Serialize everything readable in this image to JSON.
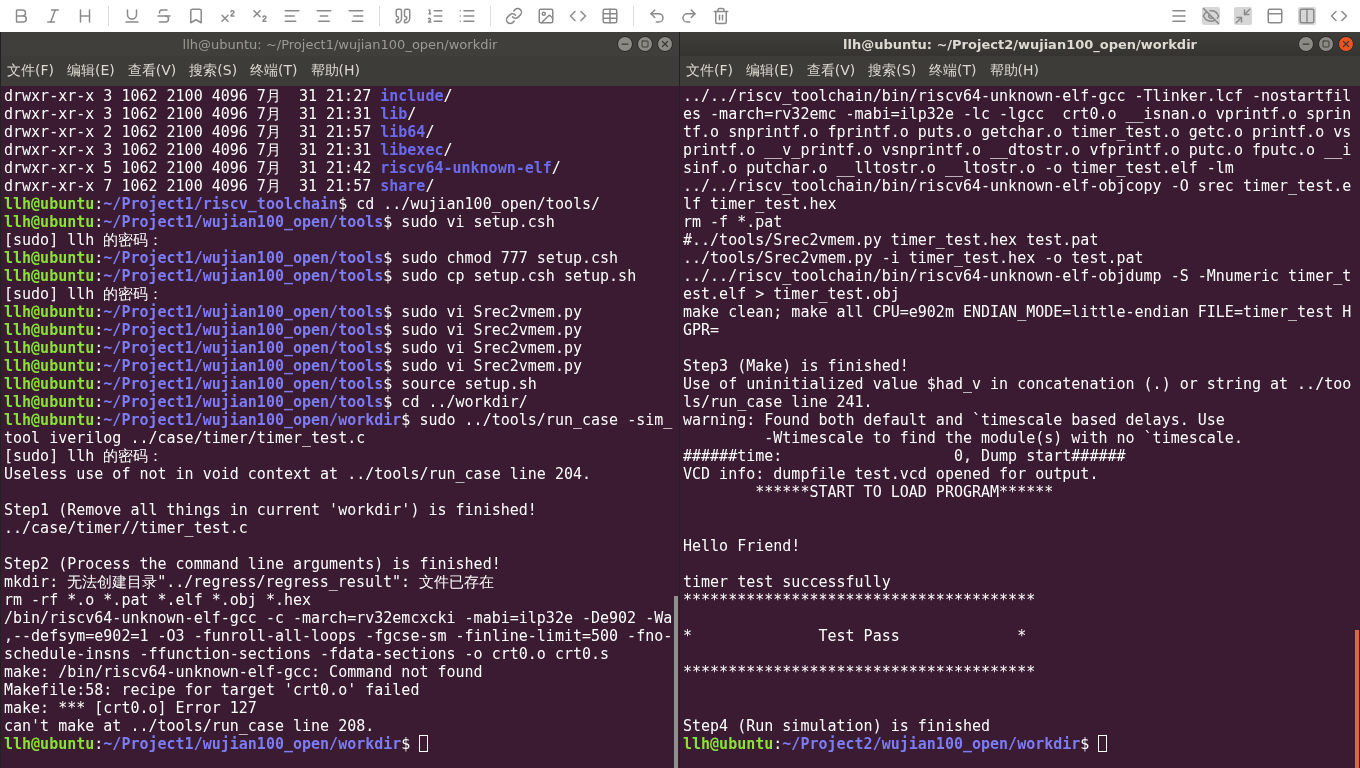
{
  "windows": [
    {
      "title": "llh@ubuntu: ~/Project1/wujian100_open/workdir",
      "active": false,
      "menu": [
        "文件(F)",
        "编辑(E)",
        "查看(V)",
        "搜索(S)",
        "终端(T)",
        "帮助(H)"
      ],
      "lines": [
        {
          "kind": "text",
          "segments": [
            {
              "kind": "plain",
              "text": "drwxr-xr-x 3 1062 2100 4096 7月  31 21:27 "
            },
            {
              "kind": "dir",
              "text": "include"
            },
            {
              "kind": "plain",
              "text": "/"
            }
          ]
        },
        {
          "kind": "text",
          "segments": [
            {
              "kind": "plain",
              "text": "drwxr-xr-x 3 1062 2100 4096 7月  31 21:31 "
            },
            {
              "kind": "dir",
              "text": "lib"
            },
            {
              "kind": "plain",
              "text": "/"
            }
          ]
        },
        {
          "kind": "text",
          "segments": [
            {
              "kind": "plain",
              "text": "drwxr-xr-x 2 1062 2100 4096 7月  31 21:57 "
            },
            {
              "kind": "dir",
              "text": "lib64"
            },
            {
              "kind": "plain",
              "text": "/"
            }
          ]
        },
        {
          "kind": "text",
          "segments": [
            {
              "kind": "plain",
              "text": "drwxr-xr-x 3 1062 2100 4096 7月  31 21:31 "
            },
            {
              "kind": "dir",
              "text": "libexec"
            },
            {
              "kind": "plain",
              "text": "/"
            }
          ]
        },
        {
          "kind": "text",
          "segments": [
            {
              "kind": "plain",
              "text": "drwxr-xr-x 5 1062 2100 4096 7月  31 21:42 "
            },
            {
              "kind": "dir",
              "text": "riscv64-unknown-elf"
            },
            {
              "kind": "plain",
              "text": "/"
            }
          ]
        },
        {
          "kind": "text",
          "segments": [
            {
              "kind": "plain",
              "text": "drwxr-xr-x 7 1062 2100 4096 7月  31 21:57 "
            },
            {
              "kind": "dir",
              "text": "share"
            },
            {
              "kind": "plain",
              "text": "/"
            }
          ]
        },
        {
          "kind": "text",
          "segments": [
            {
              "kind": "user",
              "text": "llh@ubuntu"
            },
            {
              "kind": "plain",
              "text": ":"
            },
            {
              "kind": "path",
              "text": "~/Project1/riscv_toolchain"
            },
            {
              "kind": "plain",
              "text": "$ cd ../wujian100_open/tools/"
            }
          ]
        },
        {
          "kind": "text",
          "segments": [
            {
              "kind": "user",
              "text": "llh@ubuntu"
            },
            {
              "kind": "plain",
              "text": ":"
            },
            {
              "kind": "path",
              "text": "~/Project1/wujian100_open/tools"
            },
            {
              "kind": "plain",
              "text": "$ sudo vi setup.csh"
            }
          ]
        },
        {
          "kind": "text",
          "segments": [
            {
              "kind": "plain",
              "text": "[sudo] llh 的密码："
            }
          ]
        },
        {
          "kind": "text",
          "segments": [
            {
              "kind": "user",
              "text": "llh@ubuntu"
            },
            {
              "kind": "plain",
              "text": ":"
            },
            {
              "kind": "path",
              "text": "~/Project1/wujian100_open/tools"
            },
            {
              "kind": "plain",
              "text": "$ sudo chmod 777 setup.csh"
            }
          ]
        },
        {
          "kind": "text",
          "segments": [
            {
              "kind": "user",
              "text": "llh@ubuntu"
            },
            {
              "kind": "plain",
              "text": ":"
            },
            {
              "kind": "path",
              "text": "~/Project1/wujian100_open/tools"
            },
            {
              "kind": "plain",
              "text": "$ sudo cp setup.csh setup.sh"
            }
          ]
        },
        {
          "kind": "text",
          "segments": [
            {
              "kind": "plain",
              "text": "[sudo] llh 的密码："
            }
          ]
        },
        {
          "kind": "text",
          "segments": [
            {
              "kind": "user",
              "text": "llh@ubuntu"
            },
            {
              "kind": "plain",
              "text": ":"
            },
            {
              "kind": "path",
              "text": "~/Project1/wujian100_open/tools"
            },
            {
              "kind": "plain",
              "text": "$ sudo vi Srec2vmem.py"
            }
          ]
        },
        {
          "kind": "text",
          "segments": [
            {
              "kind": "user",
              "text": "llh@ubuntu"
            },
            {
              "kind": "plain",
              "text": ":"
            },
            {
              "kind": "path",
              "text": "~/Project1/wujian100_open/tools"
            },
            {
              "kind": "plain",
              "text": "$ sudo vi Srec2vmem.py"
            }
          ]
        },
        {
          "kind": "text",
          "segments": [
            {
              "kind": "user",
              "text": "llh@ubuntu"
            },
            {
              "kind": "plain",
              "text": ":"
            },
            {
              "kind": "path",
              "text": "~/Project1/wujian100_open/tools"
            },
            {
              "kind": "plain",
              "text": "$ sudo vi Srec2vmem.py"
            }
          ]
        },
        {
          "kind": "text",
          "segments": [
            {
              "kind": "user",
              "text": "llh@ubuntu"
            },
            {
              "kind": "plain",
              "text": ":"
            },
            {
              "kind": "path",
              "text": "~/Project1/wujian100_open/tools"
            },
            {
              "kind": "plain",
              "text": "$ sudo vi Srec2vmem.py"
            }
          ]
        },
        {
          "kind": "text",
          "segments": [
            {
              "kind": "user",
              "text": "llh@ubuntu"
            },
            {
              "kind": "plain",
              "text": ":"
            },
            {
              "kind": "path",
              "text": "~/Project1/wujian100_open/tools"
            },
            {
              "kind": "plain",
              "text": "$ source setup.sh"
            }
          ]
        },
        {
          "kind": "text",
          "segments": [
            {
              "kind": "user",
              "text": "llh@ubuntu"
            },
            {
              "kind": "plain",
              "text": ":"
            },
            {
              "kind": "path",
              "text": "~/Project1/wujian100_open/tools"
            },
            {
              "kind": "plain",
              "text": "$ cd ../workdir/"
            }
          ]
        },
        {
          "kind": "text",
          "segments": [
            {
              "kind": "user",
              "text": "llh@ubuntu"
            },
            {
              "kind": "plain",
              "text": ":"
            },
            {
              "kind": "path",
              "text": "~/Project1/wujian100_open/workdir"
            },
            {
              "kind": "plain",
              "text": "$ sudo ../tools/run_case -sim_"
            }
          ]
        },
        {
          "kind": "text",
          "segments": [
            {
              "kind": "plain",
              "text": "tool iverilog ../case/timer/timer_test.c"
            }
          ]
        },
        {
          "kind": "text",
          "segments": [
            {
              "kind": "plain",
              "text": "[sudo] llh 的密码："
            }
          ]
        },
        {
          "kind": "text",
          "segments": [
            {
              "kind": "plain",
              "text": "Useless use of not in void context at ../tools/run_case line 204."
            }
          ]
        },
        {
          "kind": "blank"
        },
        {
          "kind": "text",
          "segments": [
            {
              "kind": "plain",
              "text": "Step1 (Remove all things in current 'workdir') is finished!"
            }
          ]
        },
        {
          "kind": "text",
          "segments": [
            {
              "kind": "plain",
              "text": "../case/timer//timer_test.c"
            }
          ]
        },
        {
          "kind": "blank"
        },
        {
          "kind": "text",
          "segments": [
            {
              "kind": "plain",
              "text": "Step2 (Process the command line arguments) is finished!"
            }
          ]
        },
        {
          "kind": "text",
          "segments": [
            {
              "kind": "plain",
              "text": "mkdir: 无法创建目录\"../regress/regress_result\": 文件已存在"
            }
          ]
        },
        {
          "kind": "text",
          "segments": [
            {
              "kind": "plain",
              "text": "rm -rf *.o *.pat *.elf *.obj *.hex"
            }
          ]
        },
        {
          "kind": "text",
          "segments": [
            {
              "kind": "plain",
              "text": "/bin/riscv64-unknown-elf-gcc -c -march=rv32emcxcki -mabi=ilp32e -De902 -Wa"
            }
          ]
        },
        {
          "kind": "text",
          "segments": [
            {
              "kind": "plain",
              "text": ",--defsym=e902=1 -O3 -funroll-all-loops -fgcse-sm -finline-limit=500 -fno-"
            }
          ]
        },
        {
          "kind": "text",
          "segments": [
            {
              "kind": "plain",
              "text": "schedule-insns -ffunction-sections -fdata-sections -o crt0.o crt0.s"
            }
          ]
        },
        {
          "kind": "text",
          "segments": [
            {
              "kind": "plain",
              "text": "make: /bin/riscv64-unknown-elf-gcc: Command not found"
            }
          ]
        },
        {
          "kind": "text",
          "segments": [
            {
              "kind": "plain",
              "text": "Makefile:58: recipe for target 'crt0.o' failed"
            }
          ]
        },
        {
          "kind": "text",
          "segments": [
            {
              "kind": "plain",
              "text": "make: *** [crt0.o] Error 127"
            }
          ]
        },
        {
          "kind": "text",
          "segments": [
            {
              "kind": "plain",
              "text": "can't make at ../tools/run_case line 208."
            }
          ]
        },
        {
          "kind": "text",
          "cursor": true,
          "segments": [
            {
              "kind": "user",
              "text": "llh@ubuntu"
            },
            {
              "kind": "plain",
              "text": ":"
            },
            {
              "kind": "path",
              "text": "~/Project1/wujian100_open/workdir"
            },
            {
              "kind": "plain",
              "text": "$ "
            }
          ]
        }
      ]
    },
    {
      "title": "llh@ubuntu: ~/Project2/wujian100_open/workdir",
      "active": true,
      "menu": [
        "文件(F)",
        "编辑(E)",
        "查看(V)",
        "搜索(S)",
        "终端(T)",
        "帮助(H)"
      ],
      "lines": [
        {
          "kind": "text",
          "segments": [
            {
              "kind": "plain",
              "text": "../../riscv_toolchain/bin/riscv64-unknown-elf-gcc -Tlinker.lcf -nostartfil"
            }
          ]
        },
        {
          "kind": "text",
          "segments": [
            {
              "kind": "plain",
              "text": "es -march=rv32emc -mabi=ilp32e -lc -lgcc  crt0.o __isnan.o vprintf.o sprin"
            }
          ]
        },
        {
          "kind": "text",
          "segments": [
            {
              "kind": "plain",
              "text": "tf.o snprintf.o fprintf.o puts.o getchar.o timer_test.o getc.o printf.o vs"
            }
          ]
        },
        {
          "kind": "text",
          "segments": [
            {
              "kind": "plain",
              "text": "printf.o __v_printf.o vsnprintf.o __dtostr.o vfprintf.o putc.o fputc.o __i"
            }
          ]
        },
        {
          "kind": "text",
          "segments": [
            {
              "kind": "plain",
              "text": "sinf.o putchar.o __lltostr.o __ltostr.o -o timer_test.elf -lm"
            }
          ]
        },
        {
          "kind": "text",
          "segments": [
            {
              "kind": "plain",
              "text": "../../riscv_toolchain/bin/riscv64-unknown-elf-objcopy -O srec timer_test.e"
            }
          ]
        },
        {
          "kind": "text",
          "segments": [
            {
              "kind": "plain",
              "text": "lf timer_test.hex"
            }
          ]
        },
        {
          "kind": "text",
          "segments": [
            {
              "kind": "plain",
              "text": "rm -f *.pat"
            }
          ]
        },
        {
          "kind": "text",
          "segments": [
            {
              "kind": "plain",
              "text": "#../tools/Srec2vmem.py timer_test.hex test.pat"
            }
          ]
        },
        {
          "kind": "text",
          "segments": [
            {
              "kind": "plain",
              "text": "../tools/Srec2vmem.py -i timer_test.hex -o test.pat"
            }
          ]
        },
        {
          "kind": "text",
          "segments": [
            {
              "kind": "plain",
              "text": "../../riscv_toolchain/bin/riscv64-unknown-elf-objdump -S -Mnumeric timer_t"
            }
          ]
        },
        {
          "kind": "text",
          "segments": [
            {
              "kind": "plain",
              "text": "est.elf > timer_test.obj"
            }
          ]
        },
        {
          "kind": "text",
          "segments": [
            {
              "kind": "plain",
              "text": "make clean; make all CPU=e902m ENDIAN_MODE=little-endian FILE=timer_test H"
            }
          ]
        },
        {
          "kind": "text",
          "segments": [
            {
              "kind": "plain",
              "text": "GPR="
            }
          ]
        },
        {
          "kind": "blank"
        },
        {
          "kind": "text",
          "segments": [
            {
              "kind": "plain",
              "text": "Step3 (Make) is finished!"
            }
          ]
        },
        {
          "kind": "text",
          "segments": [
            {
              "kind": "plain",
              "text": "Use of uninitialized value $had_v in concatenation (.) or string at ../too"
            }
          ]
        },
        {
          "kind": "text",
          "segments": [
            {
              "kind": "plain",
              "text": "ls/run_case line 241."
            }
          ]
        },
        {
          "kind": "text",
          "segments": [
            {
              "kind": "plain",
              "text": "warning: Found both default and `timescale based delays. Use"
            }
          ]
        },
        {
          "kind": "text",
          "segments": [
            {
              "kind": "plain",
              "text": "         -Wtimescale to find the module(s) with no `timescale."
            }
          ]
        },
        {
          "kind": "text",
          "segments": [
            {
              "kind": "plain",
              "text": "######time:                   0, Dump start######"
            }
          ]
        },
        {
          "kind": "text",
          "segments": [
            {
              "kind": "plain",
              "text": "VCD info: dumpfile test.vcd opened for output."
            }
          ]
        },
        {
          "kind": "text",
          "segments": [
            {
              "kind": "plain",
              "text": "        ******START TO LOAD PROGRAM******"
            }
          ]
        },
        {
          "kind": "blank"
        },
        {
          "kind": "blank"
        },
        {
          "kind": "text",
          "segments": [
            {
              "kind": "plain",
              "text": "Hello Friend!"
            }
          ]
        },
        {
          "kind": "blank"
        },
        {
          "kind": "text",
          "segments": [
            {
              "kind": "plain",
              "text": "timer test successfully"
            }
          ]
        },
        {
          "kind": "text",
          "segments": [
            {
              "kind": "plain",
              "text": "***************************************"
            }
          ]
        },
        {
          "kind": "blank"
        },
        {
          "kind": "text",
          "segments": [
            {
              "kind": "plain",
              "text": "*              Test Pass             *"
            }
          ]
        },
        {
          "kind": "blank"
        },
        {
          "kind": "text",
          "segments": [
            {
              "kind": "plain",
              "text": "***************************************"
            }
          ]
        },
        {
          "kind": "blank"
        },
        {
          "kind": "blank"
        },
        {
          "kind": "text",
          "segments": [
            {
              "kind": "plain",
              "text": "Step4 (Run simulation) is finished"
            }
          ]
        },
        {
          "kind": "text",
          "cursor": true,
          "segments": [
            {
              "kind": "user",
              "text": "llh@ubuntu"
            },
            {
              "kind": "plain",
              "text": ":"
            },
            {
              "kind": "path",
              "text": "~/Project2/wujian100_open/workdir"
            },
            {
              "kind": "plain",
              "text": "$ "
            }
          ]
        }
      ]
    }
  ]
}
